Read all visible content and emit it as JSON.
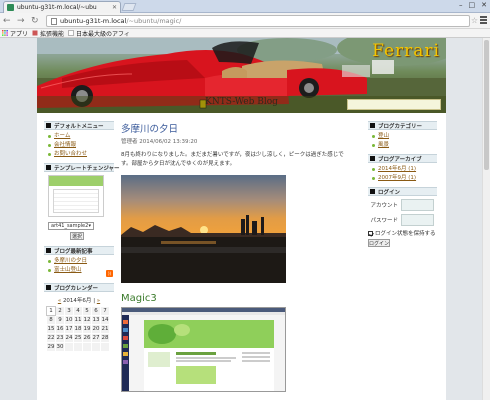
{
  "browser": {
    "tab_title": "ubuntu-g31t-m.local/~ubu",
    "url_host": "ubuntu-g31t-m.local",
    "url_path": "/~ubuntu/magic/",
    "bookmarks": [
      "アプリ",
      "拡張機能",
      "日本最大級のアフィ"
    ]
  },
  "header": {
    "title": "Ferrari",
    "blog_name": "KNTS-Web Blog"
  },
  "left_sidebar": {
    "default_menu": {
      "heading": "デフォルトメニュー",
      "items": [
        "ホーム",
        "会社情報",
        "お問い合わせ"
      ]
    },
    "template_changer": {
      "heading": "テンプレートチェンジャー",
      "selected": "art41_sample2",
      "button": "選択"
    },
    "recent_posts": {
      "heading": "ブログ最新記事",
      "items": [
        "多摩川の夕日",
        "富士山登山"
      ]
    },
    "calendar": {
      "heading": "ブログカレンダー",
      "prev": "«",
      "month_label": "2014年6月",
      "next": "»",
      "rows": [
        [
          "1",
          "2",
          "3",
          "4",
          "5",
          "6",
          "7"
        ],
        [
          "8",
          "9",
          "10",
          "11",
          "12",
          "13",
          "14"
        ],
        [
          "15",
          "16",
          "17",
          "18",
          "19",
          "20",
          "21"
        ],
        [
          "22",
          "23",
          "24",
          "25",
          "26",
          "27",
          "28"
        ],
        [
          "29",
          "30",
          "",
          "",
          "",
          "",
          ""
        ]
      ]
    }
  },
  "main": {
    "post1": {
      "title": "多摩川の夕日",
      "meta": "管理者 2014/06/02 13:39:20",
      "body": "8月も終わりになりました。まだまだ暑いですが，夜は少し涼しく，ピークは過ぎた感じです。部屋から夕日が沈んでゆくのが見えます。"
    },
    "post2": {
      "title": "Magic3"
    }
  },
  "right_sidebar": {
    "categories": {
      "heading": "ブログカテゴリー",
      "items": [
        "登山",
        "風景"
      ]
    },
    "archives": {
      "heading": "ブログアーカイブ",
      "items": [
        "2014年6月 (1)",
        "2007年9月 (1)"
      ]
    },
    "login": {
      "heading": "ログイン",
      "account_label": "アカウント",
      "password_label": "パスワード",
      "remember_label": "ログイン状態を保持する",
      "button": "ログイン"
    }
  },
  "colors": {
    "accent_green": "#7ab838",
    "link_brown": "#8a5a14",
    "title_blue": "#3a5a9a",
    "ferrari_red": "#d8141e",
    "logo_yellow": "#f4c500"
  }
}
